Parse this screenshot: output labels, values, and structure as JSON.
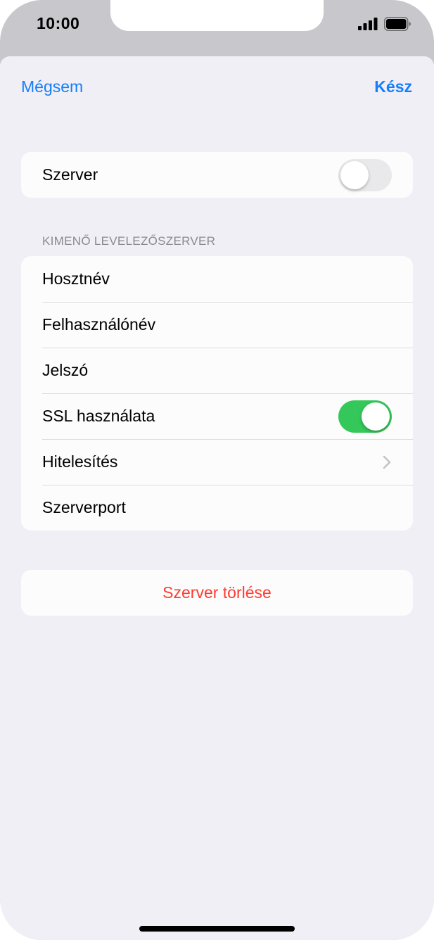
{
  "status_bar": {
    "time": "10:00"
  },
  "nav": {
    "cancel_label": "Mégsem",
    "done_label": "Kész"
  },
  "server_group": {
    "label": "Szerver",
    "toggle_on": false
  },
  "outgoing_section": {
    "header": "KIMENŐ LEVELEZŐSZERVER",
    "rows": [
      {
        "label": "Hosztnév"
      },
      {
        "label": "Felhasználónév"
      },
      {
        "label": "Jelszó"
      },
      {
        "label": "SSL használata",
        "toggle_on": true
      },
      {
        "label": "Hitelesítés",
        "accessory": "chevron-right-icon"
      },
      {
        "label": "Szerverport"
      }
    ]
  },
  "delete_button": {
    "label": "Szerver törlése"
  },
  "colors": {
    "accent": "#157efb",
    "destructive": "#ff3b30",
    "toggle_on": "#34c759",
    "toggle_off": "#e9e9eb",
    "background": "#f0eff5"
  }
}
